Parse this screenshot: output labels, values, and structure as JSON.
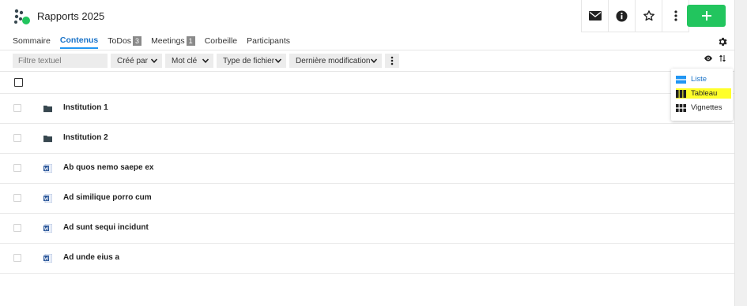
{
  "header": {
    "title": "Rapports 2025",
    "add_label": "+"
  },
  "tabs": [
    {
      "label": "Sommaire",
      "badge": ""
    },
    {
      "label": "Contenus",
      "badge": ""
    },
    {
      "label": "ToDos",
      "badge": "3"
    },
    {
      "label": "Meetings",
      "badge": "1"
    },
    {
      "label": "Corbeille",
      "badge": ""
    },
    {
      "label": "Participants",
      "badge": ""
    }
  ],
  "active_tab": "Contenus",
  "filters": {
    "search_placeholder": "Filtre textuel",
    "created_by": "Créé par",
    "keyword": "Mot clé",
    "file_type": "Type de fichier",
    "last_modified": "Dernière modification"
  },
  "items": [
    {
      "title": "Institution 1",
      "type": "folder"
    },
    {
      "title": "Institution 2",
      "type": "folder"
    },
    {
      "title": "Ab quos nemo saepe ex",
      "type": "word"
    },
    {
      "title": "Ad similique porro cum",
      "type": "word"
    },
    {
      "title": "Ad sunt sequi incidunt",
      "type": "word"
    },
    {
      "title": "Ad unde eius a",
      "type": "word"
    }
  ],
  "view_menu": {
    "list": "Liste",
    "table": "Tableau",
    "thumbnails": "Vignettes"
  },
  "icons": {
    "header": [
      "mail-icon",
      "info-icon",
      "star-icon",
      "more-vertical-icon"
    ],
    "filterbar": [
      "more-vertical-icon",
      "eye-icon",
      "sort-icon"
    ],
    "settings": "gear-icon"
  },
  "colors": {
    "accent": "#2196f3",
    "add_button": "#22c55e",
    "highlight": "#ffff2a",
    "folder": "#37474f",
    "word": "#2b579a"
  }
}
